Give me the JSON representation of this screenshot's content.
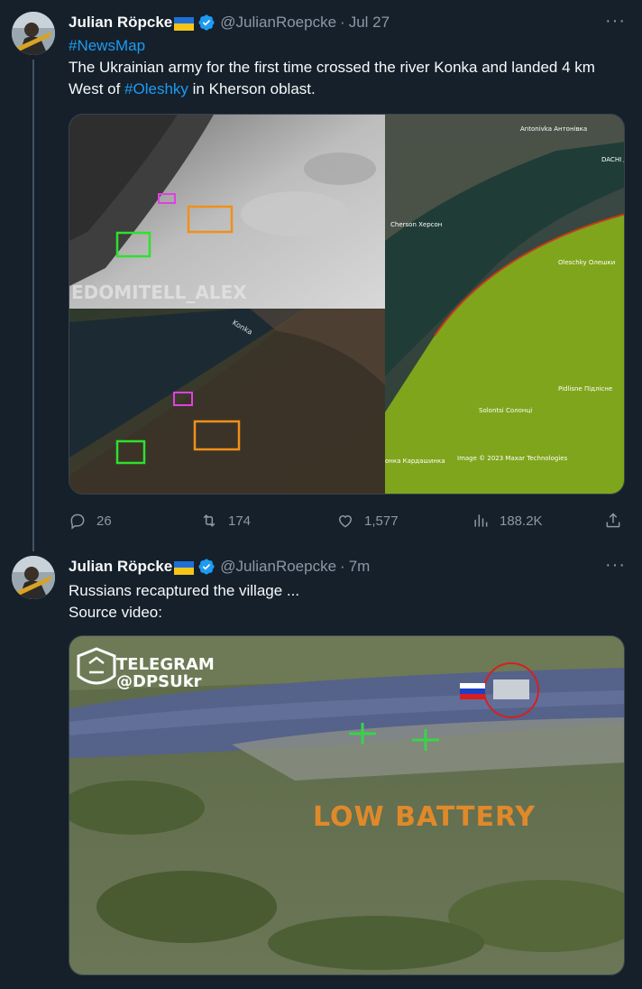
{
  "tweets": [
    {
      "name": "Julian Röpcke",
      "handle": "@JulianRoepcke",
      "separator": "·",
      "time": "Jul 27",
      "hashtag_line": "#NewsMap",
      "text_part1": "The Ukrainian army for the first time crossed the river Konka and landed 4 km West of ",
      "text_link": "#Oleshky",
      "text_part2": " in Kherson oblast.",
      "media": {
        "map_labels": {
          "antonivka": "Antonivka Антонівка",
          "kherson": "Cherson Херсон",
          "oleshky": "Oleschky Олешки",
          "pidlisne": "Pidlisne Підлісне",
          "solontsi": "Solontsi Солонці",
          "kardashynka": "онка Кардашинка",
          "copyright": "Image © 2023 Maxar Technologies",
          "dachi": "DACHI Д",
          "konka": "Konka"
        },
        "watermark": "EDOMITELL_ALEX"
      },
      "stats": {
        "replies": "26",
        "retweets": "174",
        "likes": "1,577",
        "views": "188.2K"
      }
    },
    {
      "name": "Julian Röpcke",
      "handle": "@JulianRoepcke",
      "separator": "·",
      "time": "7m",
      "text_line1": "Russians recaptured the village ...",
      "text_line2": "Source video:",
      "media": {
        "telegram_label": "TELEGRAM",
        "channel_label": "@DPSUkr",
        "overlay_text": "LOW BATTERY"
      }
    }
  ],
  "icons": {
    "reply": "reply-icon",
    "retweet": "retweet-icon",
    "like": "like-icon",
    "views": "views-icon",
    "share": "share-icon",
    "more": "more-icon",
    "verified": "verified-icon"
  },
  "colors": {
    "background": "#15202b",
    "text": "#f7f9f9",
    "secondary": "#8b98a5",
    "link": "#1d9bf0",
    "border": "#38444d"
  }
}
